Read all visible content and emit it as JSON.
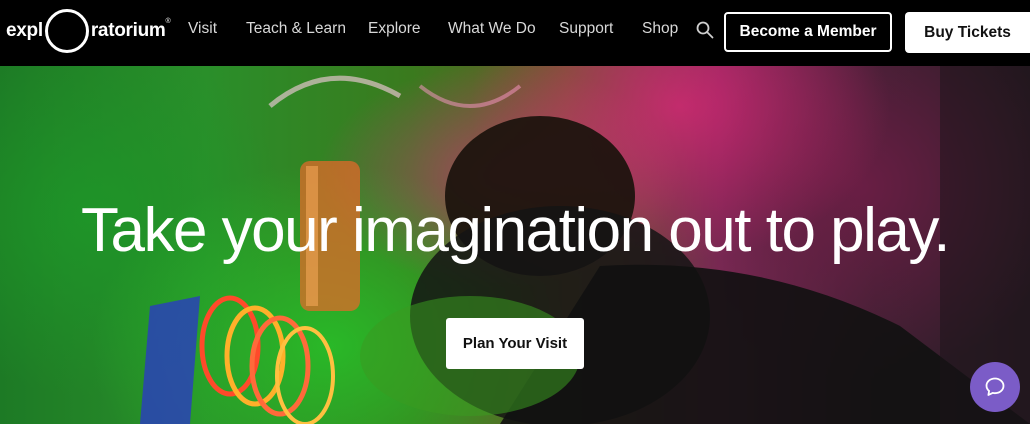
{
  "brand": {
    "logo_left": "expl",
    "logo_right": "ratorium",
    "logo_mark": "®"
  },
  "nav": {
    "items": [
      {
        "label": "Visit"
      },
      {
        "label": "Teach & Learn"
      },
      {
        "label": "Explore"
      },
      {
        "label": "What We Do"
      },
      {
        "label": "Support"
      },
      {
        "label": "Shop"
      }
    ],
    "search_icon": "search-icon"
  },
  "header_actions": {
    "member_label": "Become a Member",
    "tickets_label": "Buy Tickets"
  },
  "hero": {
    "headline": "Take your imagination out to play.",
    "cta_label": "Plan Your Visit"
  },
  "chat": {
    "icon": "chat-bubble-icon",
    "color": "#7b5cc7"
  },
  "colors": {
    "header_bg": "#000000",
    "text_light": "#ffffff",
    "nav_text": "#d8d8d8"
  }
}
